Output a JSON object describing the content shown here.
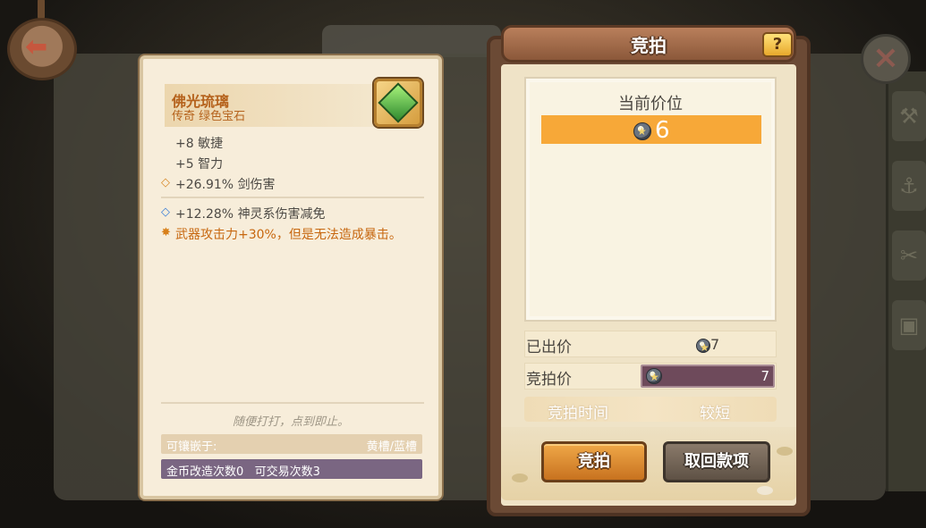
{
  "item": {
    "name": "佛光琉璃",
    "subtitle": "传奇 绿色宝石",
    "icon": "green-gem-icon",
    "stats": [
      "+8 敏捷",
      "+5 智力"
    ],
    "orange_stat": "+26.91% 剑伤害",
    "blue_stat": "+12.28% 神灵系伤害减免",
    "special_effect": "武器攻击力+30%，但是无法造成暴击。",
    "flavor_text": "随便打打，点到即止。",
    "socket_label": "可镶嵌于:",
    "socket_value": "黄槽/蓝槽",
    "trade_info": "金币改造次数0   可交易次数3"
  },
  "auction": {
    "title": "竞拍",
    "help_label": "?",
    "current_price_label": "当前价位",
    "current_price": "6",
    "bid_given_label": "已出价",
    "bid_given": "7",
    "bid_price_label": "竞拍价",
    "bid_price": "7",
    "time_label": "竞拍时间",
    "time_value": "较短",
    "bid_button": "竞拍",
    "retrieve_button": "取回款项"
  },
  "colors": {
    "accent_orange": "#f7a838",
    "item_name": "#b5621c",
    "trade_bar": "#7a6682"
  }
}
